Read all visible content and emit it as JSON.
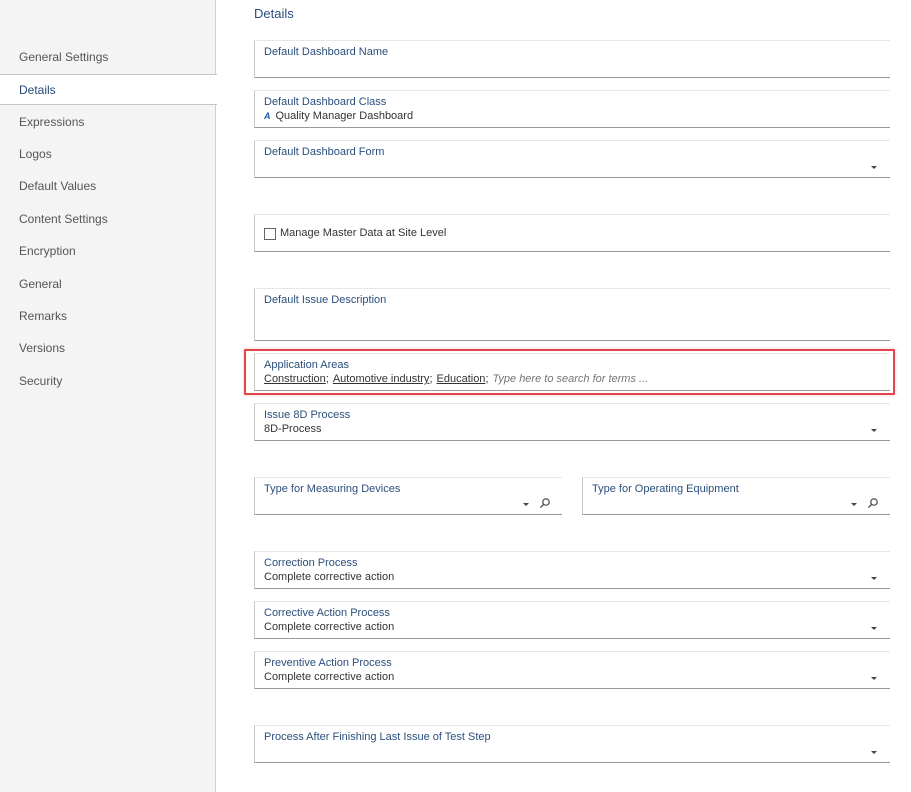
{
  "sidebar": {
    "items": [
      {
        "label": "General Settings"
      },
      {
        "label": "Details"
      },
      {
        "label": "Expressions"
      },
      {
        "label": "Logos"
      },
      {
        "label": "Default Values"
      },
      {
        "label": "Content Settings"
      },
      {
        "label": "Encryption"
      },
      {
        "label": "General"
      },
      {
        "label": "Remarks"
      },
      {
        "label": "Versions"
      },
      {
        "label": "Security"
      }
    ],
    "active_index": 1
  },
  "main": {
    "title": "Details",
    "fields": {
      "dashboard_name": {
        "label": "Default Dashboard Name",
        "value": ""
      },
      "dashboard_class": {
        "label": "Default Dashboard Class",
        "value": "Quality Manager Dashboard",
        "icon": "class-icon"
      },
      "dashboard_form": {
        "label": "Default Dashboard Form",
        "value": ""
      },
      "manage_master": {
        "label": "Manage Master Data at Site Level",
        "checked": false
      },
      "issue_description": {
        "label": "Default Issue Description",
        "value": ""
      },
      "application_areas": {
        "label": "Application Areas",
        "tags": [
          "Construction",
          "Automotive industry",
          "Education"
        ],
        "placeholder": "Type here to search for terms ..."
      },
      "issue_8d": {
        "label": "Issue 8D Process",
        "value": "8D-Process"
      },
      "measuring_devices": {
        "label": "Type for Measuring Devices",
        "value": ""
      },
      "operating_equipment": {
        "label": "Type for Operating Equipment",
        "value": ""
      },
      "correction_process": {
        "label": "Correction Process",
        "value": "Complete corrective action"
      },
      "corrective_action": {
        "label": "Corrective Action Process",
        "value": "Complete corrective action"
      },
      "preventive_action": {
        "label": "Preventive Action Process",
        "value": "Complete corrective action"
      },
      "process_after": {
        "label": "Process After Finishing Last Issue of Test Step",
        "value": ""
      }
    }
  },
  "colors": {
    "label": "#2b4f7c",
    "highlight": "#e0474c",
    "sidebar_bg": "#f4f4f4"
  }
}
